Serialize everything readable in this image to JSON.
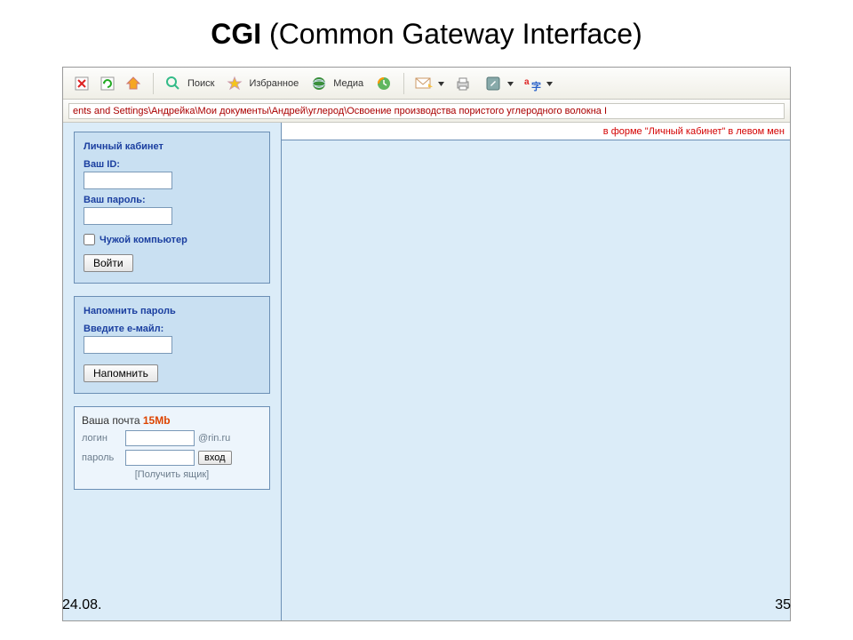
{
  "slide": {
    "title_bold": "CGI",
    "title_rest": " (Common Gateway Interface)",
    "footer_left": "24.08.",
    "footer_right": "35"
  },
  "toolbar": {
    "search_label": "Поиск",
    "favorites_label": "Избранное",
    "media_label": "Медиа"
  },
  "addressbar": {
    "value": "ents and Settings\\Андрейка\\Мои документы\\Андрей\\углерод\\Освоение производства пористого углеродного волокна I"
  },
  "main": {
    "red_message": "в форме \"Личный кабинет\" в левом мен"
  },
  "login_panel": {
    "title": "Личный кабинет",
    "id_label": "Ваш ID:",
    "password_label": "Ваш пароль:",
    "foreign_pc_label": "Чужой компьютер",
    "submit_label": "Войти"
  },
  "remind_panel": {
    "title": "Напомнить пароль",
    "email_label": "Введите е-майл:",
    "submit_label": "Напомнить"
  },
  "mail_panel": {
    "title_text": "Ваша почта ",
    "title_size": "15Mb",
    "login_label": "логин",
    "domain": "@rin.ru",
    "password_label": "пароль",
    "submit_label": "вход",
    "get_box_label": "[Получить ящик]"
  }
}
